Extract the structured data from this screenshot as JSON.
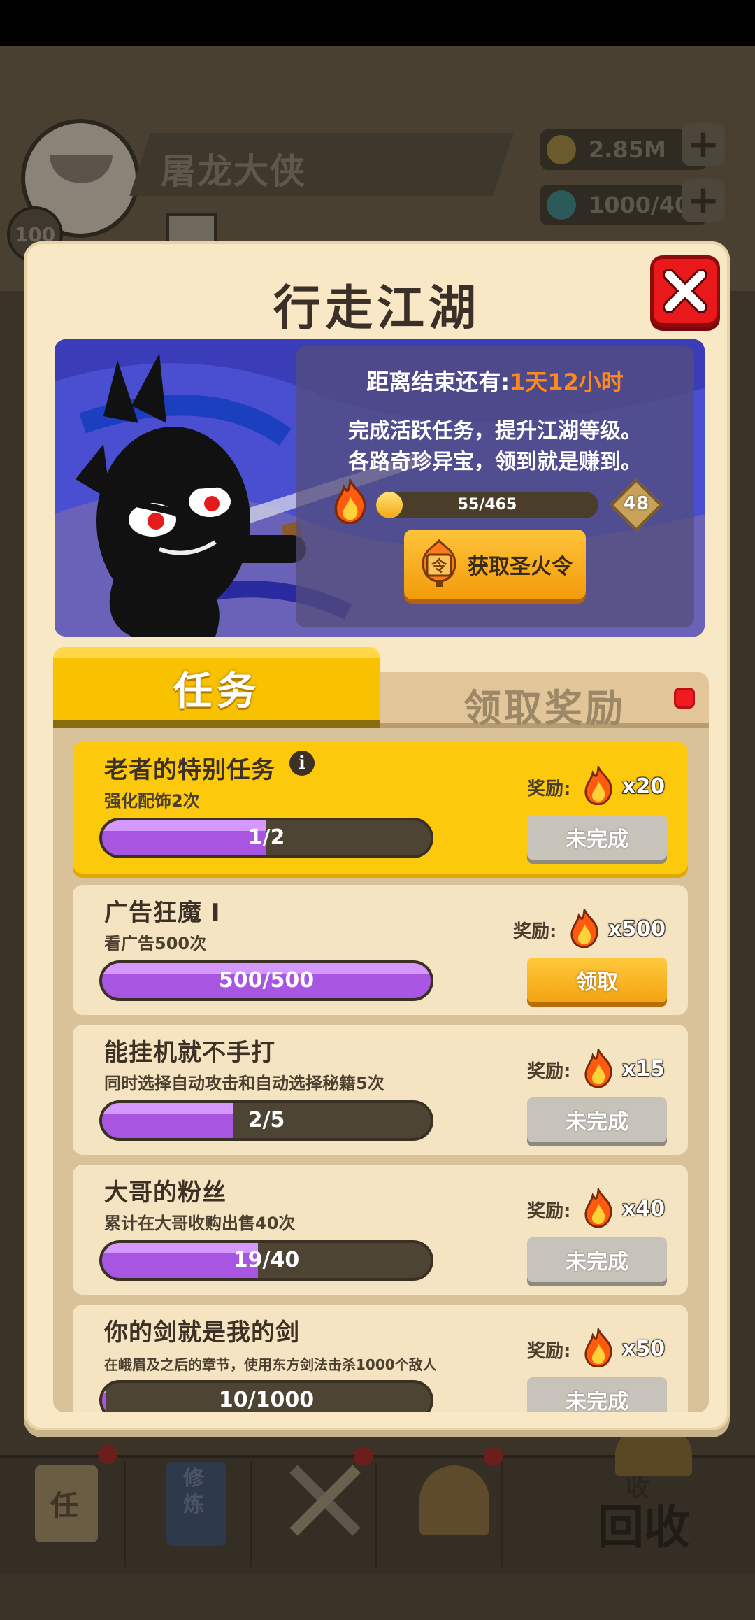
{
  "background": {
    "player_name": "屠龙大侠",
    "player_level": "100",
    "gold": "2.85M",
    "gems": "1000/40",
    "dock": {
      "task_icon_text": "任",
      "cultivate_text": "修炼",
      "recycle_small": "收",
      "recycle_label": "回收"
    }
  },
  "modal": {
    "title": "行走江湖",
    "countdown_label": "距离结束还有:",
    "countdown_value": "1天12小时",
    "desc_line1": "完成活跃任务，提升江湖等级。",
    "desc_line2": "各路奇珍异宝，领到就是赚到。",
    "xp_text": "55/465",
    "xp_progress": 0.118,
    "level": "48",
    "token_button": "获取圣火令",
    "token_icon_char": "令"
  },
  "tabs": {
    "tasks": "任务",
    "rewards": "领取奖励"
  },
  "tasks": [
    {
      "name": "老者的特别任务",
      "desc": "强化配饰2次",
      "progress_text": "1/2",
      "progress": 0.5,
      "reward_label": "奖励:",
      "reward_count": "x20",
      "button": "未完成"
    },
    {
      "name": "广告狂魔 I",
      "desc": "看广告500次",
      "progress_text": "500/500",
      "progress": 1.0,
      "reward_label": "奖励:",
      "reward_count": "x500",
      "button": "领取"
    },
    {
      "name": "能挂机就不手打",
      "desc": "同时选择自动攻击和自动选择秘籍5次",
      "progress_text": "2/5",
      "progress": 0.4,
      "reward_label": "奖励:",
      "reward_count": "x15",
      "button": "未完成"
    },
    {
      "name": "大哥的粉丝",
      "desc": "累计在大哥收购出售40次",
      "progress_text": "19/40",
      "progress": 0.475,
      "reward_label": "奖励:",
      "reward_count": "x40",
      "button": "未完成"
    },
    {
      "name": "你的剑就是我的剑",
      "desc": "在峨眉及之后的章节，使用东方剑法击杀1000个敌人",
      "progress_text": "10/1000",
      "progress": 0.01,
      "reward_label": "奖励:",
      "reward_count": "x50",
      "button": "未完成"
    }
  ],
  "colors": {
    "accent_yellow": "#fcc90c",
    "progress_purple": "#a855e2",
    "close_red": "#e8181b",
    "countdown_orange": "#ff8a1c"
  }
}
